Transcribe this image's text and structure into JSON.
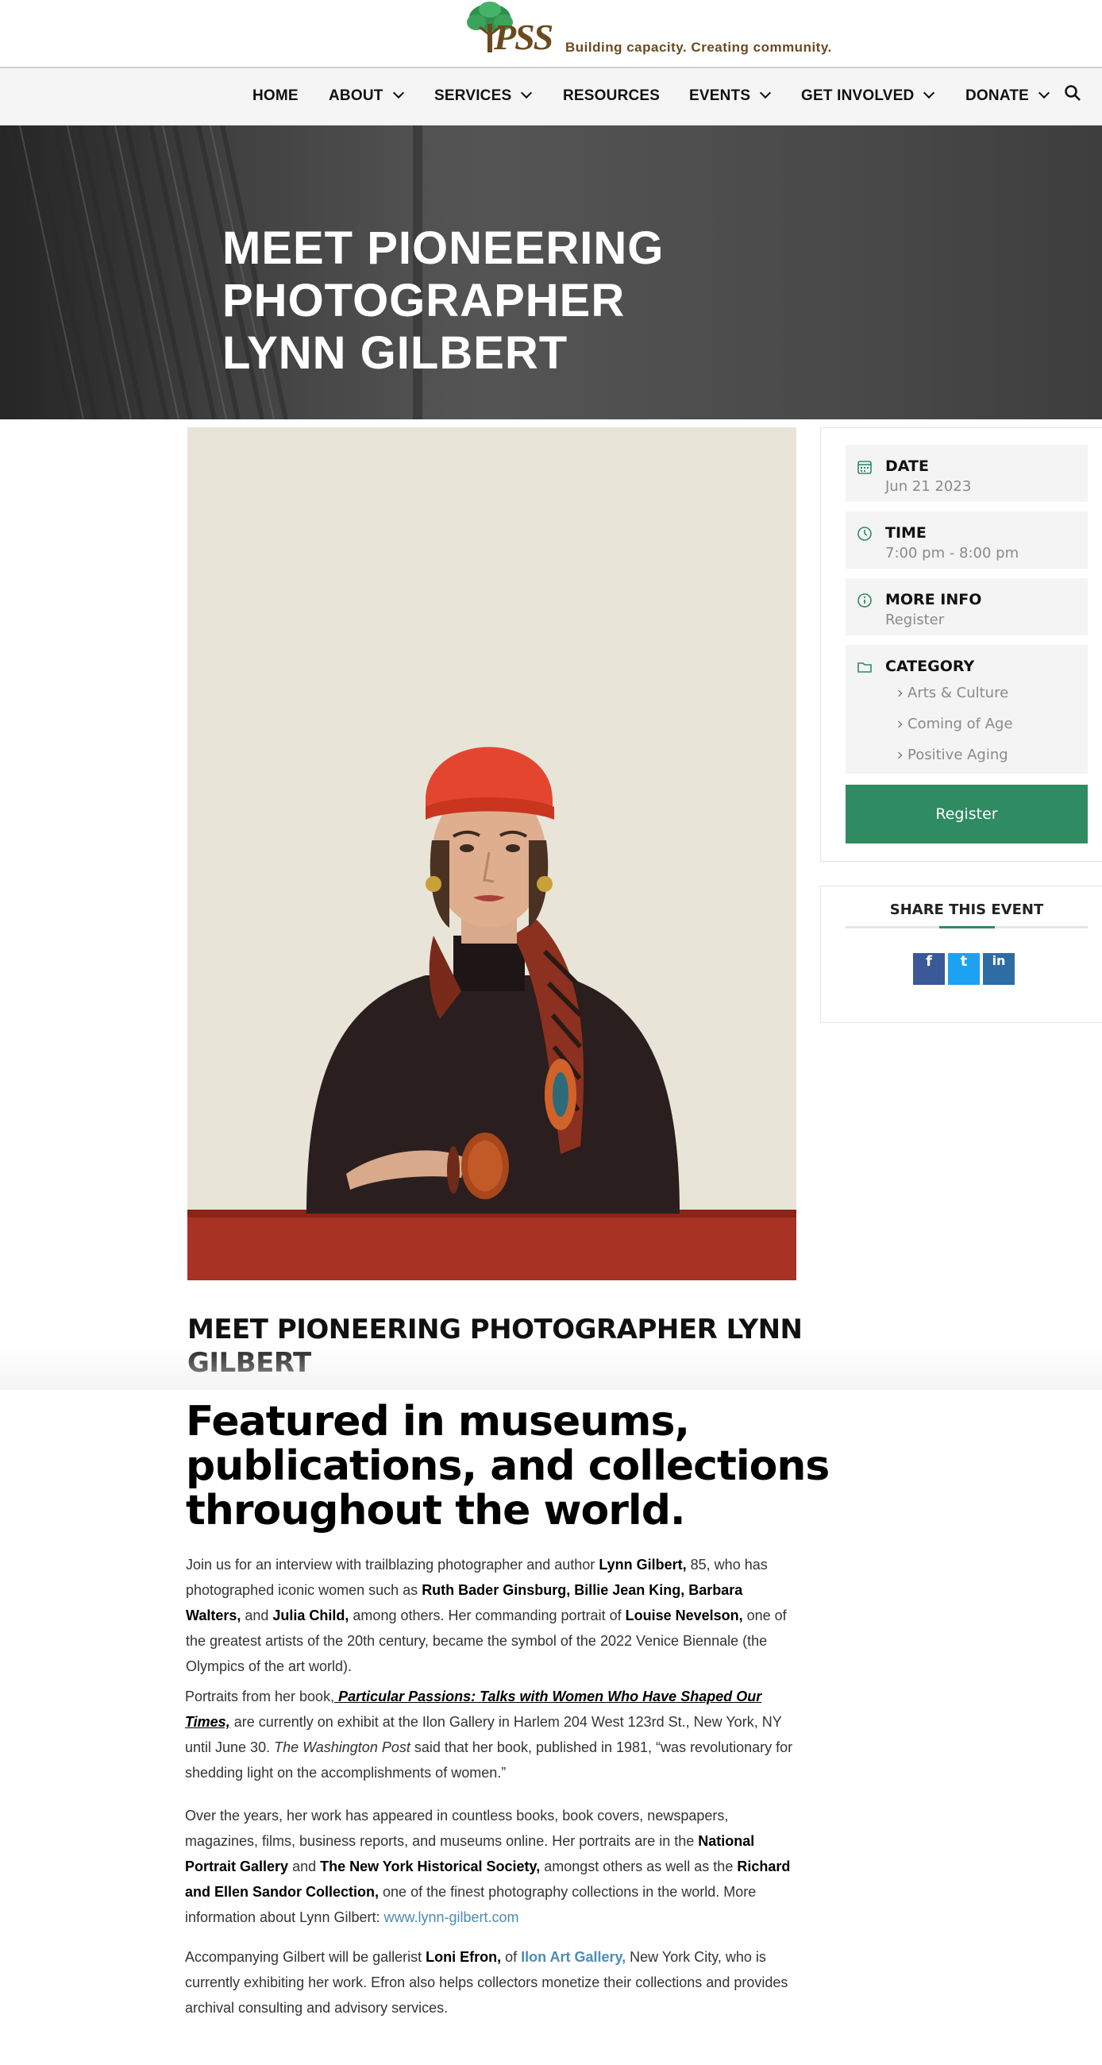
{
  "site": {
    "logo_text": "PSS",
    "tagline": "Building capacity. Creating community."
  },
  "nav": {
    "items": [
      {
        "label": "HOME",
        "dropdown": false
      },
      {
        "label": "ABOUT",
        "dropdown": true
      },
      {
        "label": "SERVICES",
        "dropdown": true
      },
      {
        "label": "RESOURCES",
        "dropdown": false
      },
      {
        "label": "EVENTS",
        "dropdown": true
      },
      {
        "label": "GET INVOLVED",
        "dropdown": true
      },
      {
        "label": "DONATE",
        "dropdown": true
      }
    ],
    "search_icon": "search-icon"
  },
  "hero": {
    "title_line1": "MEET PIONEERING PHOTOGRAPHER",
    "title_line2": "LYNN GILBERT"
  },
  "event": {
    "date_label": "DATE",
    "date_value": "Jun 21 2023",
    "time_label": "TIME",
    "time_value": "7:00 pm - 8:00 pm",
    "more_info_label": "MORE INFO",
    "more_info_value": "Register",
    "category_label": "CATEGORY",
    "categories": [
      "Arts & Culture",
      "Coming of Age",
      "Positive Aging"
    ],
    "register_button": "Register"
  },
  "share": {
    "title": "SHARE THIS EVENT",
    "buttons": [
      {
        "icon": "facebook-icon",
        "glyph": "f",
        "color": "#3b5998"
      },
      {
        "icon": "twitter-icon",
        "glyph": "t",
        "color": "#1da1f2"
      },
      {
        "icon": "linkedin-icon",
        "glyph": "in",
        "color": "#2e6da4"
      }
    ]
  },
  "article": {
    "subtitle": "MEET PIONEERING PHOTOGRAPHER LYNN GILBERT",
    "headline": "Featured in museums, publications, and collections throughout the world.",
    "p1": {
      "t1": "Join us for an interview with trailblazing photographer and author ",
      "b1": "Lynn Gilbert,",
      "t2": " 85, who has photographed iconic women such as ",
      "b2": "Ruth Bader Ginsburg, Billie Jean King, Barbara Walters,",
      "t3": " and ",
      "b3": "Julia Child,",
      "t4": " among others. Her commanding portrait of ",
      "b4": "Louise Nevelson,",
      "t5": " one of the greatest artists of the 20th century, became the symbol of the 2022 Venice Biennale (the Olympics of the art world)."
    },
    "p2": {
      "t1": "Portraits from her book,",
      "bi1": " Particular Passions: Talks with Women Who Have Shaped Our Times,",
      "t2": " are currently on exhibit at the Ilon Gallery in Harlem 204 West 123rd St., New York, NY until June 30. ",
      "i1": "The Washington Post",
      "t3": " said that her book, published in 1981, “was revolutionary for shedding light on the accomplishments of women.”"
    },
    "p3": {
      "t1": "Over the years, her work has appeared in countless books, book covers, newspapers, magazines, films, business reports, and museums online. Her portraits are in the ",
      "b1": "National Portrait Gallery",
      "t2": " and ",
      "b2": "The New York Historical Society,",
      "t3": " amongst others as well as the ",
      "b3": "Richard and Ellen Sandor Collection,",
      "t4": " one of the finest photography collections in the world. More information about Lynn Gilbert: ",
      "link": "www.lynn-gilbert.com"
    },
    "p4": {
      "t1": "Accompanying Gilbert will be gallerist ",
      "b1": "Loni Efron,",
      "t2": " of ",
      "link": "Ilon Art Gallery,",
      "t3": " New York City, who is currently exhibiting her work. Efron also helps collectors monetize their collections and provides archival consulting and advisory services."
    }
  },
  "colors": {
    "accent": "#2e8b62",
    "link": "#4d8bb5",
    "hat": "#e4452f"
  }
}
